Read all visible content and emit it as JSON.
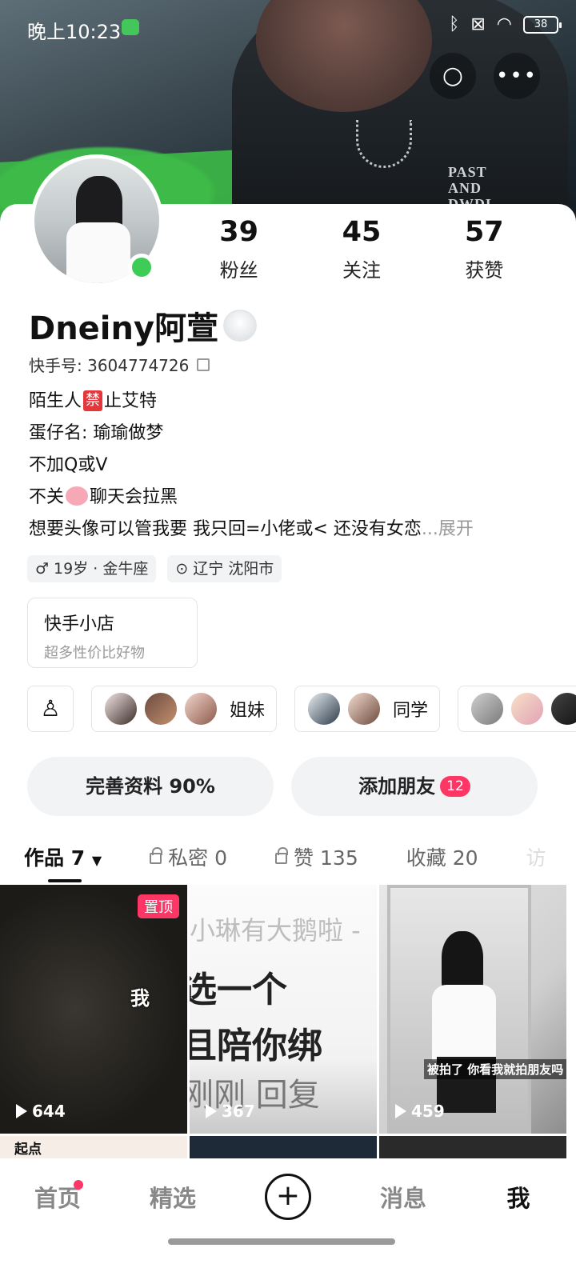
{
  "status_bar": {
    "time": "晚上10:23",
    "battery": "38"
  },
  "profile": {
    "nickname": "Dneiny阿萱",
    "kuaishou_id": "快手号: 3604774726",
    "stats": [
      {
        "num": "39",
        "label": "粉丝"
      },
      {
        "num": "45",
        "label": "关注"
      },
      {
        "num": "57",
        "label": "获赞"
      }
    ],
    "bio": {
      "line1_a": "陌生人",
      "line1_ban": "禁",
      "line1_b": "止艾特",
      "line2": "蛋仔名: 瑜瑜做梦",
      "line3": "不加Q或V",
      "line4_a": "不关",
      "line4_b": "聊天会拉黑",
      "line5": "想要头像可以管我要 我只回=小佬或< 还没有女恋",
      "more": "...展开"
    },
    "tags": [
      "19岁 · 金牛座",
      "辽宁 沈阳市"
    ]
  },
  "shop": {
    "title": "快手小店",
    "subtitle": "超多性价比好物"
  },
  "friend_groups": [
    {
      "name": "姐妹"
    },
    {
      "name": "同学"
    }
  ],
  "actions": {
    "complete_profile": "完善资料 90%",
    "add_friends": "添加朋友",
    "add_friends_badge": "12"
  },
  "tabs": [
    {
      "label": "作品",
      "count": "7"
    },
    {
      "label": "私密",
      "count": "0"
    },
    {
      "label": "赞",
      "count": "135"
    },
    {
      "label": "收藏",
      "count": "20"
    },
    {
      "label": "访",
      "count": ""
    }
  ],
  "videos": [
    {
      "plays": "644",
      "pinned": "置顶",
      "text": "我"
    },
    {
      "plays": "367",
      "line1": "小琳有大鹅啦 -",
      "line2": "选一个",
      "line3": "且陪你绑",
      "line4": "刚刚  回复"
    },
    {
      "plays": "459",
      "caption": "被拍了 你看我就拍朋友吗"
    }
  ],
  "row2": {
    "qidian": "起点"
  },
  "bottom_nav": [
    "首页",
    "精选",
    "+",
    "消息",
    "我"
  ],
  "colors": {
    "accent_pink": "#fe3666",
    "online_green": "#3dcc56",
    "button_bg": "#f2f3f5"
  },
  "icons": [
    "search-icon",
    "more-icon",
    "bluetooth-icon",
    "wifi-icon",
    "battery-icon",
    "qr-code-icon",
    "location-pin-icon",
    "gender-icon",
    "add-friend-icon",
    "lock-icon",
    "play-icon",
    "plus-icon"
  ]
}
